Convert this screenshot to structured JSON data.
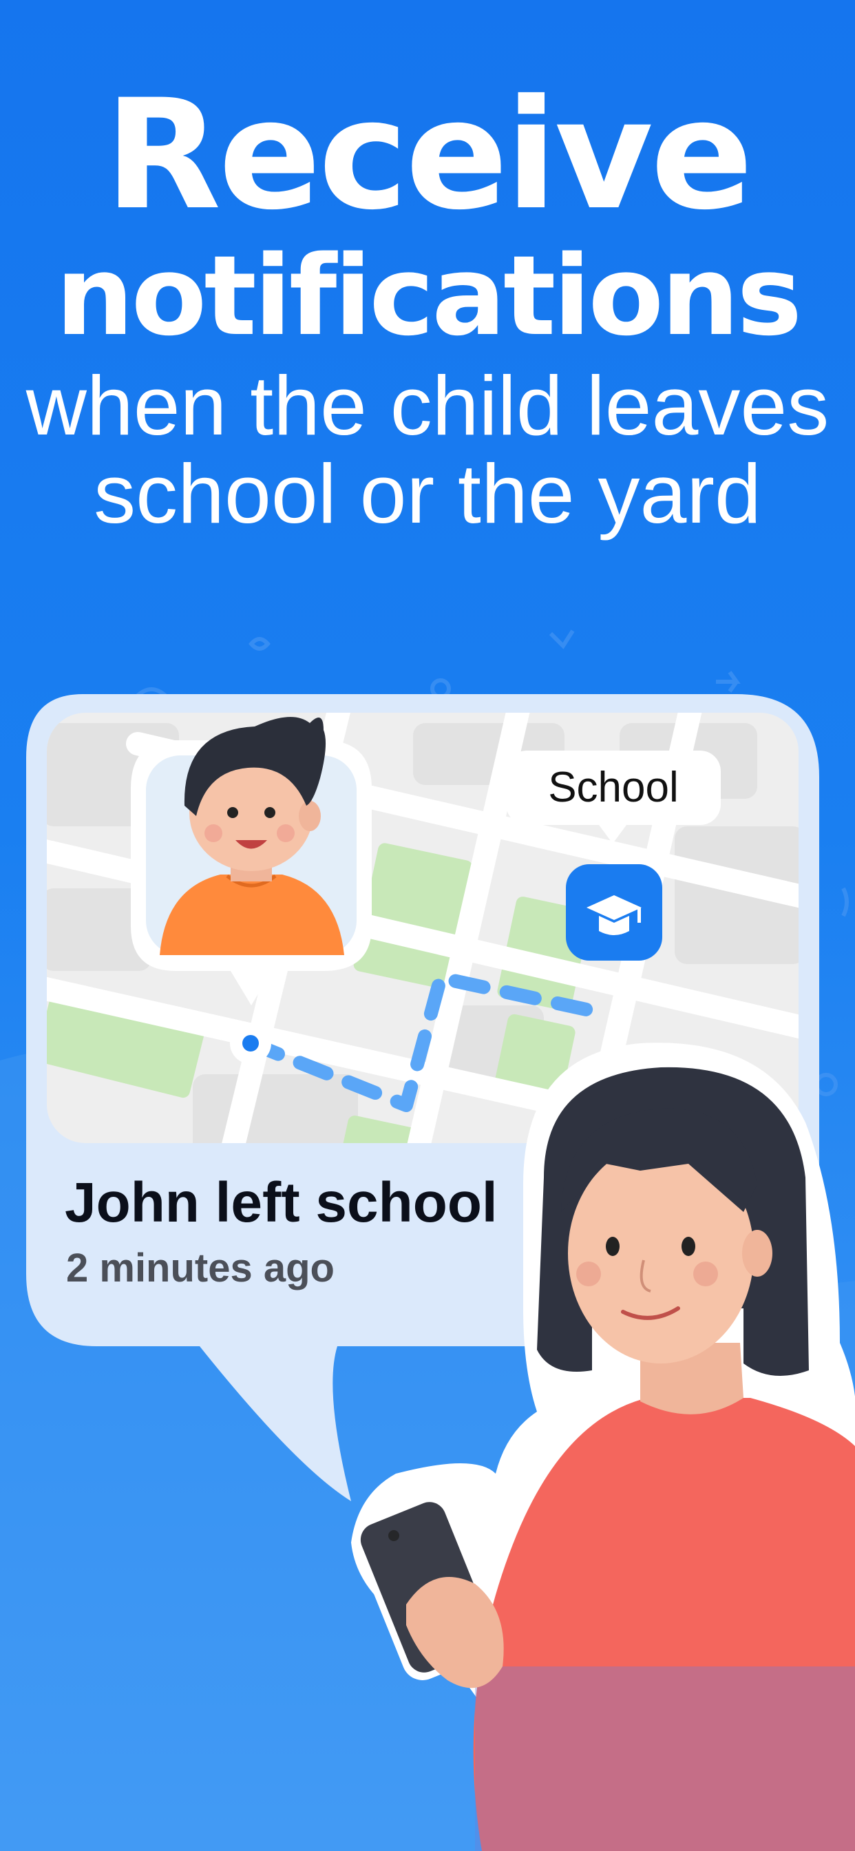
{
  "headline": {
    "line1": "Receive",
    "line2": "notifications",
    "subtitle": "when the child leaves school or the yard"
  },
  "map": {
    "place_label": "School",
    "place_icon": "graduation-cap-icon",
    "child_avatar": "boy-avatar",
    "route_color": "#5aa6f7"
  },
  "notification": {
    "title": "John left school",
    "time": "2 minutes ago"
  },
  "colors": {
    "background": "#1a7cf0",
    "card": "#dbe9fb",
    "accent": "#1a7cf0",
    "park": "#c8e8b8"
  }
}
